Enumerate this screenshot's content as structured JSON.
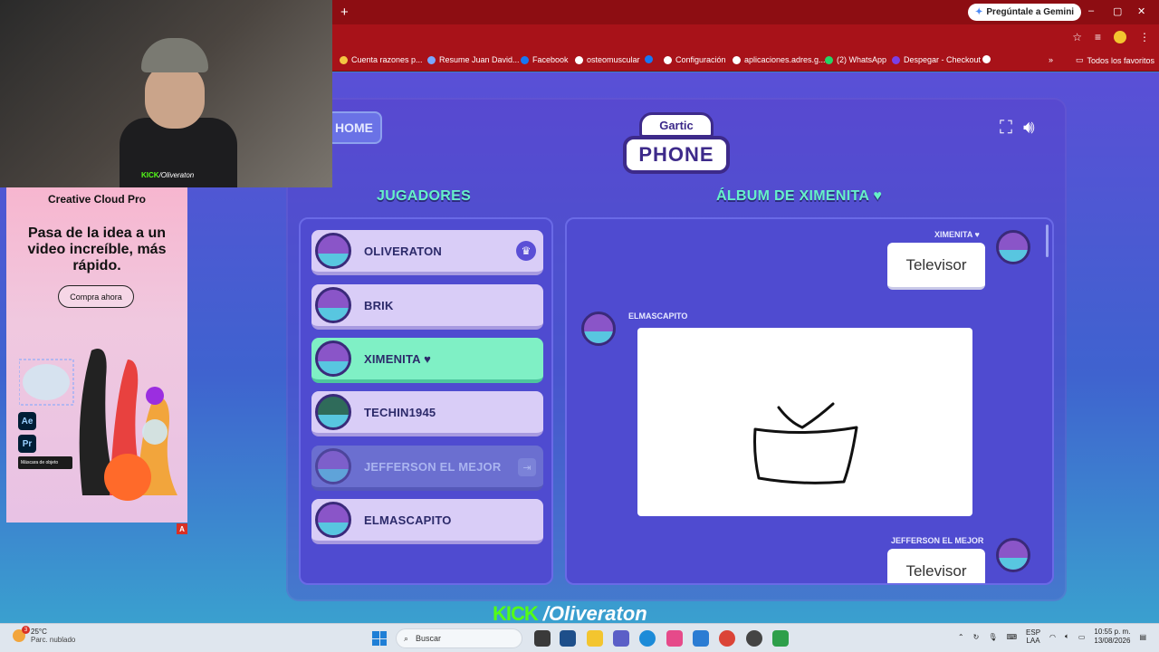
{
  "browser": {
    "new_tab_symbol": "+",
    "gemini_label": "Pregúntale a Gemini",
    "window_controls": [
      "–",
      "▢",
      "✕"
    ],
    "bookmarks": [
      {
        "label": "Cuenta razones p...",
        "icon": "bookmark-icon"
      },
      {
        "label": "Resume Juan David...",
        "icon": "bookmark-icon"
      },
      {
        "label": "Facebook",
        "icon": "facebook-icon"
      },
      {
        "label": "osteomuscular",
        "icon": "globe-icon"
      },
      {
        "label": "Configuración",
        "icon": "gear-icon"
      },
      {
        "label": "aplicaciones.adres.g...",
        "icon": "globe-icon"
      },
      {
        "label": "(2) WhatsApp",
        "icon": "whatsapp-icon"
      },
      {
        "label": "Despegar - Checkout",
        "icon": "bookmark-icon"
      }
    ],
    "all_bookmarks_label": "Todos los favoritos"
  },
  "game": {
    "home_label": "HOME",
    "logo_top": "Gartic",
    "logo_bottom": "PHONE",
    "players_title": "JUGADORES",
    "album_title": "ÁLBUM DE XIMENITA ♥",
    "players": [
      {
        "name": "OLIVERATON",
        "state": "host"
      },
      {
        "name": "BRIK",
        "state": "normal"
      },
      {
        "name": "XIMENITA ♥",
        "state": "active"
      },
      {
        "name": "TECHIN1945",
        "state": "normal"
      },
      {
        "name": "JEFFERSON EL MEJOR",
        "state": "left"
      },
      {
        "name": "ELMASCAPITO",
        "state": "normal"
      }
    ],
    "album": {
      "messages": [
        {
          "author": "XIMENITA ♥",
          "text": "Televisor",
          "side": "right"
        },
        {
          "author": "ELMASCAPITO",
          "type": "drawing",
          "side": "left"
        },
        {
          "author": "JEFFERSON EL MEJOR",
          "text": "Televisor",
          "side": "right"
        }
      ]
    }
  },
  "overlay": {
    "kick_logo": "KICK",
    "kick_handle": "/Oliveraton",
    "cam_kick_logo": "KICK",
    "cam_handle": "/Oliveraton"
  },
  "ad": {
    "brand": "Creative Cloud Pro",
    "headline": "Pasa de la idea a un video increíble, más rápido.",
    "cta": "Compra ahora",
    "app_icons": [
      "Ae",
      "Pr"
    ],
    "chip": "Máscara de objeto",
    "badge": "A"
  },
  "taskbar": {
    "weather_badge": "3",
    "temperature": "25°C",
    "condition": "Parc. nublado",
    "search_placeholder": "Buscar",
    "lang_top": "ESP",
    "lang_bottom": "LAA",
    "time": "10:55 p. m.",
    "date": "13/08/2026"
  },
  "colors": {
    "accent_green": "#53fc18",
    "title_teal": "#66f0c8",
    "chrome_red": "#a81219"
  }
}
